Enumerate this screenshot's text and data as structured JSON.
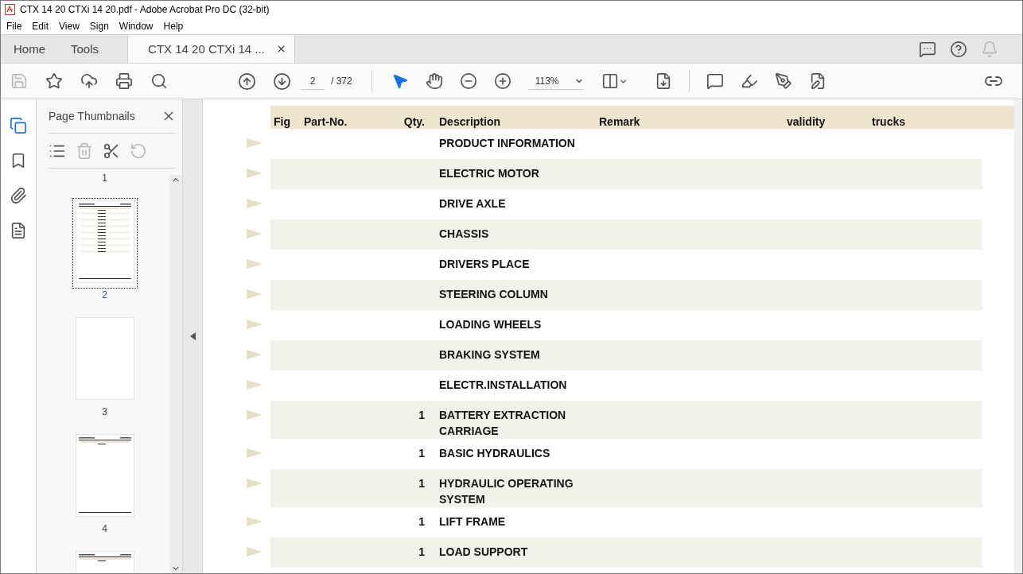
{
  "window": {
    "title": "CTX 14 20 CTXi 14 20.pdf - Adobe Acrobat Pro DC (32-bit)"
  },
  "menu": [
    "File",
    "Edit",
    "View",
    "Sign",
    "Window",
    "Help"
  ],
  "tabs": [
    {
      "label": "Home",
      "kind": "nav",
      "selected": false
    },
    {
      "label": "Tools",
      "kind": "nav",
      "selected": false
    },
    {
      "label": "CTX 14 20 CTXi 14 ...",
      "kind": "document",
      "selected": true
    }
  ],
  "tab_tools": [
    {
      "kind": "chat",
      "disabled": false
    },
    {
      "kind": "help",
      "disabled": false
    },
    {
      "kind": "bell",
      "disabled": true
    }
  ],
  "toolbar": {
    "left": [
      {
        "kind": "save",
        "disabled": true
      },
      {
        "kind": "star",
        "disabled": false
      },
      {
        "kind": "upload",
        "disabled": false
      },
      {
        "kind": "print",
        "disabled": false
      },
      {
        "kind": "find",
        "disabled": false
      }
    ],
    "nav": [
      {
        "kind": "up",
        "disabled": false
      },
      {
        "kind": "down",
        "disabled": false
      }
    ],
    "page_field": {
      "value": "2"
    },
    "page_total": "/ 372",
    "view": [
      {
        "kind": "select",
        "selected": true
      },
      {
        "kind": "hand",
        "selected": false
      },
      {
        "kind": "zoom-out",
        "selected": false
      },
      {
        "kind": "zoom-in",
        "selected": false
      }
    ],
    "zoom_field": {
      "value": "113%"
    },
    "right": [
      {
        "kind": "comment"
      },
      {
        "kind": "highlight"
      },
      {
        "kind": "sign"
      },
      {
        "kind": "edit"
      }
    ]
  },
  "rail": [
    {
      "kind": "pages",
      "selected": true
    },
    {
      "kind": "bookmarks",
      "selected": false
    },
    {
      "kind": "attachments",
      "selected": false
    },
    {
      "kind": "document",
      "selected": false
    }
  ],
  "thumbnails_panel": {
    "title": "Page Thumbnails",
    "tools": [
      {
        "kind": "options",
        "disabled": false
      },
      {
        "kind": "delete",
        "disabled": true
      },
      {
        "kind": "extract",
        "disabled": false
      },
      {
        "kind": "undo",
        "disabled": true
      }
    ],
    "thumbnails": [
      {
        "label": "1",
        "selected": false
      },
      {
        "label": "2",
        "kind": "table",
        "selected": true
      },
      {
        "label": "3",
        "kind": "blank",
        "selected": false
      },
      {
        "label": "4",
        "kind": "short",
        "selected": false
      },
      {
        "kind": "short",
        "selected": false
      }
    ]
  },
  "table": {
    "columns": [
      "Fig",
      "Part-No.",
      "Qty.",
      "Description",
      "Remark",
      "validity",
      "trucks"
    ],
    "rows": [
      {
        "description": "PRODUCT INFORMATION"
      },
      {
        "description": "ELECTRIC MOTOR"
      },
      {
        "description": "DRIVE AXLE"
      },
      {
        "description": "CHASSIS"
      },
      {
        "description": "DRIVERS PLACE"
      },
      {
        "description": "STEERING COLUMN"
      },
      {
        "description": "LOADING WHEELS"
      },
      {
        "description": "BRAKING SYSTEM"
      },
      {
        "description": "ELECTR.INSTALLATION"
      },
      {
        "qty": "1",
        "description": "BATTERY EXTRACTION CARRIAGE"
      },
      {
        "qty": "1",
        "description": "BASIC HYDRAULICS"
      },
      {
        "qty": "1",
        "description": "HYDRAULIC OPERATING SYSTEM"
      },
      {
        "qty": "1",
        "description": "LIFT FRAME"
      },
      {
        "qty": "1",
        "description": "LOAD SUPPORT"
      }
    ]
  }
}
